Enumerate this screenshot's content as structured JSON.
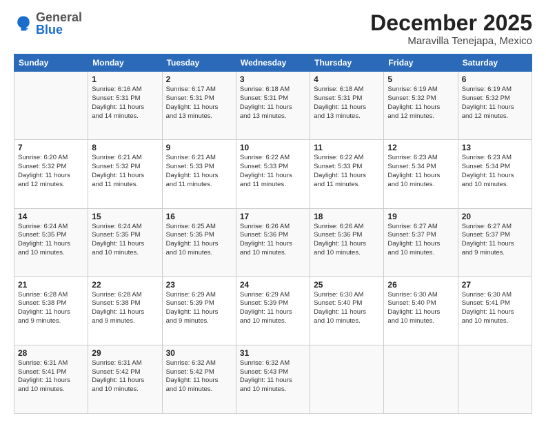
{
  "header": {
    "logo": {
      "general": "General",
      "blue": "Blue"
    },
    "title": "December 2025",
    "location": "Maravilla Tenejapa, Mexico"
  },
  "weekdays": [
    "Sunday",
    "Monday",
    "Tuesday",
    "Wednesday",
    "Thursday",
    "Friday",
    "Saturday"
  ],
  "weeks": [
    [
      {
        "day": "",
        "info": ""
      },
      {
        "day": "1",
        "info": "Sunrise: 6:16 AM\nSunset: 5:31 PM\nDaylight: 11 hours\nand 14 minutes."
      },
      {
        "day": "2",
        "info": "Sunrise: 6:17 AM\nSunset: 5:31 PM\nDaylight: 11 hours\nand 13 minutes."
      },
      {
        "day": "3",
        "info": "Sunrise: 6:18 AM\nSunset: 5:31 PM\nDaylight: 11 hours\nand 13 minutes."
      },
      {
        "day": "4",
        "info": "Sunrise: 6:18 AM\nSunset: 5:31 PM\nDaylight: 11 hours\nand 13 minutes."
      },
      {
        "day": "5",
        "info": "Sunrise: 6:19 AM\nSunset: 5:32 PM\nDaylight: 11 hours\nand 12 minutes."
      },
      {
        "day": "6",
        "info": "Sunrise: 6:19 AM\nSunset: 5:32 PM\nDaylight: 11 hours\nand 12 minutes."
      }
    ],
    [
      {
        "day": "7",
        "info": "Sunrise: 6:20 AM\nSunset: 5:32 PM\nDaylight: 11 hours\nand 12 minutes."
      },
      {
        "day": "8",
        "info": "Sunrise: 6:21 AM\nSunset: 5:32 PM\nDaylight: 11 hours\nand 11 minutes."
      },
      {
        "day": "9",
        "info": "Sunrise: 6:21 AM\nSunset: 5:33 PM\nDaylight: 11 hours\nand 11 minutes."
      },
      {
        "day": "10",
        "info": "Sunrise: 6:22 AM\nSunset: 5:33 PM\nDaylight: 11 hours\nand 11 minutes."
      },
      {
        "day": "11",
        "info": "Sunrise: 6:22 AM\nSunset: 5:33 PM\nDaylight: 11 hours\nand 11 minutes."
      },
      {
        "day": "12",
        "info": "Sunrise: 6:23 AM\nSunset: 5:34 PM\nDaylight: 11 hours\nand 10 minutes."
      },
      {
        "day": "13",
        "info": "Sunrise: 6:23 AM\nSunset: 5:34 PM\nDaylight: 11 hours\nand 10 minutes."
      }
    ],
    [
      {
        "day": "14",
        "info": "Sunrise: 6:24 AM\nSunset: 5:35 PM\nDaylight: 11 hours\nand 10 minutes."
      },
      {
        "day": "15",
        "info": "Sunrise: 6:24 AM\nSunset: 5:35 PM\nDaylight: 11 hours\nand 10 minutes."
      },
      {
        "day": "16",
        "info": "Sunrise: 6:25 AM\nSunset: 5:35 PM\nDaylight: 11 hours\nand 10 minutes."
      },
      {
        "day": "17",
        "info": "Sunrise: 6:26 AM\nSunset: 5:36 PM\nDaylight: 11 hours\nand 10 minutes."
      },
      {
        "day": "18",
        "info": "Sunrise: 6:26 AM\nSunset: 5:36 PM\nDaylight: 11 hours\nand 10 minutes."
      },
      {
        "day": "19",
        "info": "Sunrise: 6:27 AM\nSunset: 5:37 PM\nDaylight: 11 hours\nand 10 minutes."
      },
      {
        "day": "20",
        "info": "Sunrise: 6:27 AM\nSunset: 5:37 PM\nDaylight: 11 hours\nand 9 minutes."
      }
    ],
    [
      {
        "day": "21",
        "info": "Sunrise: 6:28 AM\nSunset: 5:38 PM\nDaylight: 11 hours\nand 9 minutes."
      },
      {
        "day": "22",
        "info": "Sunrise: 6:28 AM\nSunset: 5:38 PM\nDaylight: 11 hours\nand 9 minutes."
      },
      {
        "day": "23",
        "info": "Sunrise: 6:29 AM\nSunset: 5:39 PM\nDaylight: 11 hours\nand 9 minutes."
      },
      {
        "day": "24",
        "info": "Sunrise: 6:29 AM\nSunset: 5:39 PM\nDaylight: 11 hours\nand 10 minutes."
      },
      {
        "day": "25",
        "info": "Sunrise: 6:30 AM\nSunset: 5:40 PM\nDaylight: 11 hours\nand 10 minutes."
      },
      {
        "day": "26",
        "info": "Sunrise: 6:30 AM\nSunset: 5:40 PM\nDaylight: 11 hours\nand 10 minutes."
      },
      {
        "day": "27",
        "info": "Sunrise: 6:30 AM\nSunset: 5:41 PM\nDaylight: 11 hours\nand 10 minutes."
      }
    ],
    [
      {
        "day": "28",
        "info": "Sunrise: 6:31 AM\nSunset: 5:41 PM\nDaylight: 11 hours\nand 10 minutes."
      },
      {
        "day": "29",
        "info": "Sunrise: 6:31 AM\nSunset: 5:42 PM\nDaylight: 11 hours\nand 10 minutes."
      },
      {
        "day": "30",
        "info": "Sunrise: 6:32 AM\nSunset: 5:42 PM\nDaylight: 11 hours\nand 10 minutes."
      },
      {
        "day": "31",
        "info": "Sunrise: 6:32 AM\nSunset: 5:43 PM\nDaylight: 11 hours\nand 10 minutes."
      },
      {
        "day": "",
        "info": ""
      },
      {
        "day": "",
        "info": ""
      },
      {
        "day": "",
        "info": ""
      }
    ]
  ]
}
